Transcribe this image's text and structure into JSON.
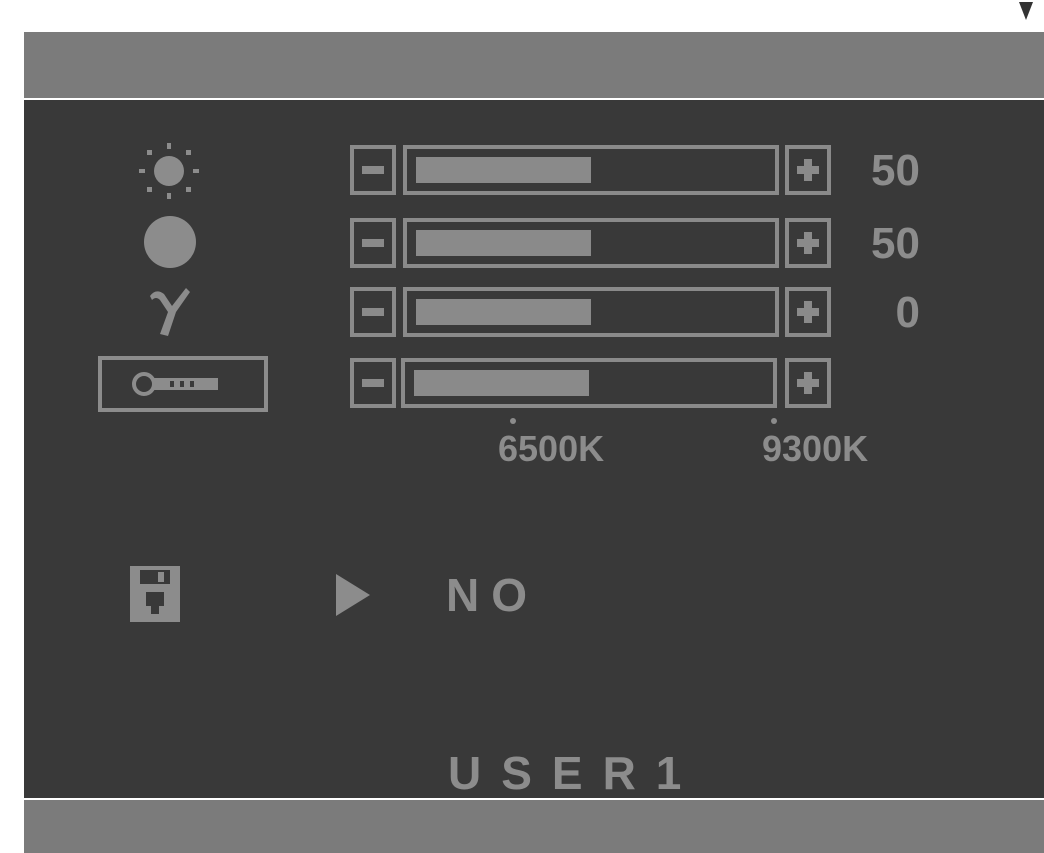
{
  "osd": {
    "adjustments": [
      {
        "id": "brightness",
        "icon": "brightness-sun-icon",
        "level": 50,
        "value_text": "50"
      },
      {
        "id": "contrast",
        "icon": "contrast-circle-icon",
        "level": 50,
        "value_text": "50"
      },
      {
        "id": "gamma",
        "icon": "gamma-symbol-icon",
        "level": 50,
        "value_text": "0"
      },
      {
        "id": "color-temperature",
        "icon": "color-temperature-icon",
        "level": 50,
        "value_text": ""
      }
    ],
    "color_temperature_ticks": [
      "6500K",
      "9300K"
    ],
    "save": {
      "icon": "save-floppy-icon",
      "pointer_icon": "triangle-right-icon",
      "value": "NO"
    },
    "mode_label": "USER1"
  },
  "colors": {
    "panel": "#393939",
    "bands": "#7b7b7b",
    "foreground": "#8c8c8c"
  }
}
